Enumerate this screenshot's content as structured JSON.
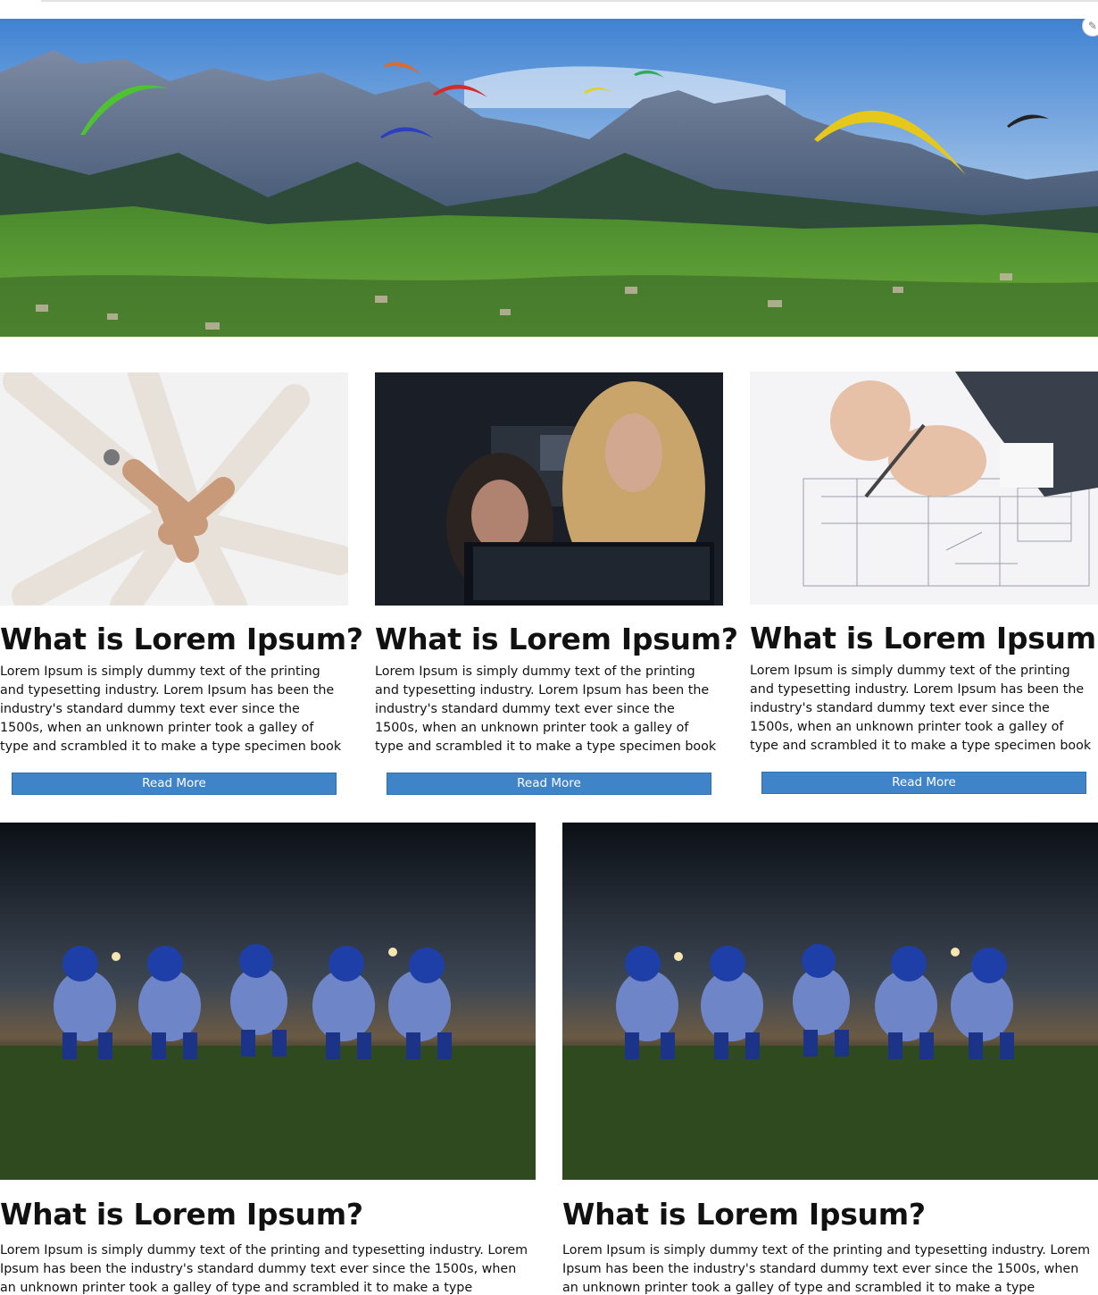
{
  "hero": {
    "image_desc": "hero-banner"
  },
  "cards": [
    {
      "title": "What is Lorem Ipsum?",
      "body": "Lorem Ipsum is simply dummy text of the printing and typesetting industry. Lorem Ipsum has been the industry's standard dummy text ever since the 1500s, when an unknown printer took a galley of type and scrambled it to make a type specimen book",
      "button": "Read More"
    },
    {
      "title": "What is Lorem Ipsum?",
      "body": "Lorem Ipsum is simply dummy text of the printing and typesetting industry. Lorem Ipsum has been the industry's standard dummy text ever since the 1500s, when an unknown printer took a galley of type and scrambled it to make a type specimen book",
      "button": "Read More"
    },
    {
      "title": "What is Lorem Ipsum?",
      "body": "Lorem Ipsum is simply dummy text of the printing and typesetting industry. Lorem Ipsum has been the industry's standard dummy text ever since the 1500s, when an unknown printer took a galley of type and scrambled it to make a type specimen book",
      "button": "Read More"
    }
  ],
  "wide_cards": [
    {
      "title": "What is Lorem Ipsum?",
      "body": "Lorem Ipsum is simply dummy text of the printing and typesetting industry. Lorem Ipsum has been the industry's standard dummy text ever since the 1500s, when an unknown printer took a galley of type and scrambled it to make a type specimen book"
    },
    {
      "title": "What is Lorem Ipsum?",
      "body": "Lorem Ipsum is simply dummy text of the printing and typesetting industry. Lorem Ipsum has been the industry's standard dummy text ever since the 1500s, when an unknown printer took a galley of type and scrambled it to make a type specimen book"
    }
  ],
  "colors": {
    "button": "#3f84c9",
    "text": "#111111"
  },
  "icons": [
    "pencil-icon"
  ]
}
